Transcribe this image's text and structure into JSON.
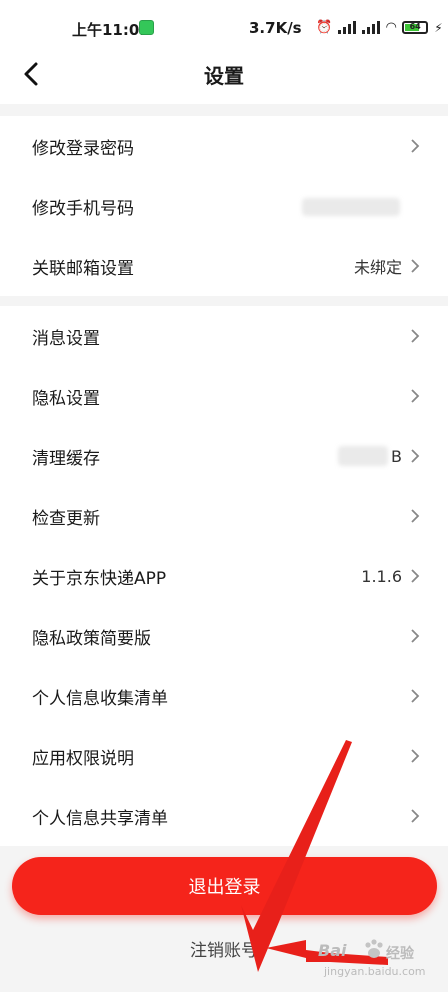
{
  "status": {
    "time": "上午11:01",
    "speed": "3.7K/s",
    "battery_level": "64"
  },
  "header": {
    "title": "设置"
  },
  "groups": [
    {
      "items": [
        {
          "label": "修改登录密码",
          "value": ""
        },
        {
          "label": "修改手机号码",
          "value": ""
        },
        {
          "label": "关联邮箱设置",
          "value": "未绑定"
        }
      ]
    },
    {
      "items": [
        {
          "label": "消息设置",
          "value": ""
        },
        {
          "label": "隐私设置",
          "value": ""
        },
        {
          "label": "清理缓存",
          "value": "B"
        },
        {
          "label": "检查更新",
          "value": ""
        },
        {
          "label": "关于京东快递APP",
          "value": "1.1.6"
        },
        {
          "label": "隐私政策简要版",
          "value": ""
        },
        {
          "label": "个人信息收集清单",
          "value": ""
        },
        {
          "label": "应用权限说明",
          "value": ""
        },
        {
          "label": "个人信息共享清单",
          "value": ""
        }
      ]
    }
  ],
  "actions": {
    "logout_label": "退出登录",
    "cancel_account_label": "注销账号"
  },
  "watermark": {
    "brand_left": "Bai",
    "brand_right": "经验",
    "domain": "jingyan.baidu.com"
  },
  "colors": {
    "accent": "#f5241b",
    "annotation_arrow": "#e8201a",
    "background": "#f4f4f4"
  },
  "icons": {
    "back": "chevron-left-icon",
    "row_arrow": "chevron-right-icon"
  }
}
